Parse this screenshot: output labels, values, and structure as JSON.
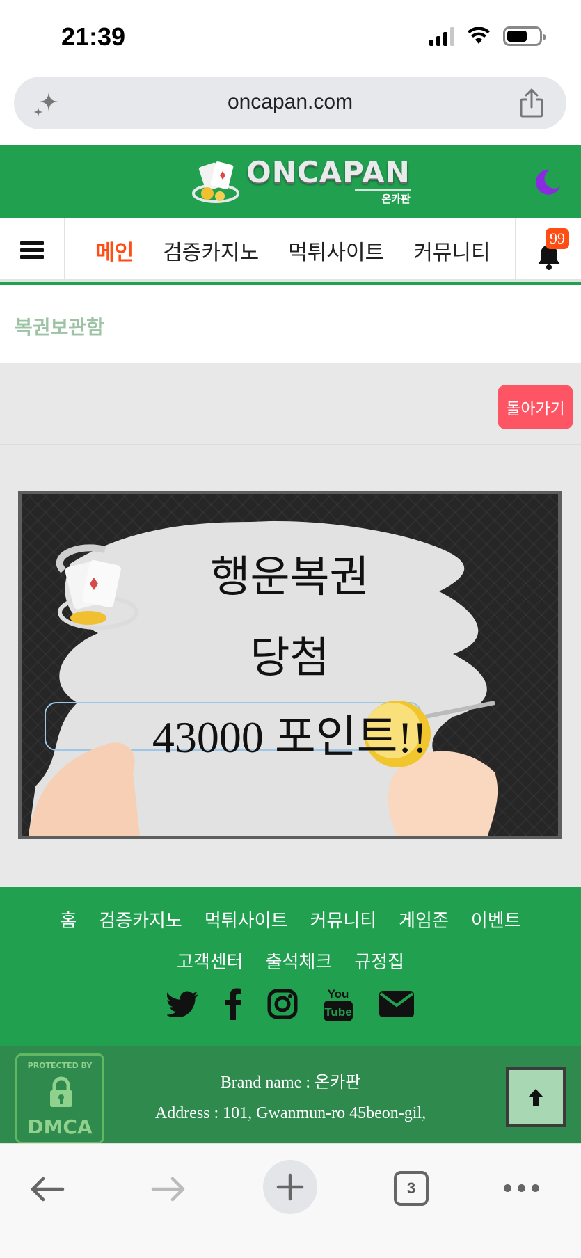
{
  "status_bar": {
    "time": "21:39"
  },
  "browser": {
    "url": "oncapan.com",
    "tab_count": "3"
  },
  "header": {
    "logo_text": "ONCAPAN",
    "logo_sub": "온카판"
  },
  "nav": {
    "items": [
      "메인",
      "검증카지노",
      "먹튀사이트",
      "커뮤니티"
    ],
    "notification_count": "99"
  },
  "breadcrumb": "복권보관함",
  "main": {
    "back_label": "돌아가기",
    "banner": {
      "line1": "행운복권",
      "line2": "당첨",
      "line3": "43000 포인트!!"
    }
  },
  "footer": {
    "links_row1": [
      "홈",
      "검증카지노",
      "먹튀사이트",
      "커뮤니티",
      "게임존",
      "이벤트"
    ],
    "links_row2": [
      "고객센터",
      "출석체크",
      "규정집"
    ],
    "social_icons": [
      "twitter-icon",
      "facebook-icon",
      "instagram-icon",
      "youtube-icon",
      "email-icon"
    ],
    "dmca_top": "PROTECTED BY",
    "dmca_bottom": "DMCA",
    "brand": "Brand name : 온카판",
    "address": "Address : 101, Gwanmun-ro 45beon-gil,"
  },
  "colors": {
    "brand_green": "#21a050",
    "footer_dark_green": "#2f8a4e",
    "active_nav": "#ff4d14",
    "back_button": "#fe5565",
    "moon": "#8a2be2"
  }
}
